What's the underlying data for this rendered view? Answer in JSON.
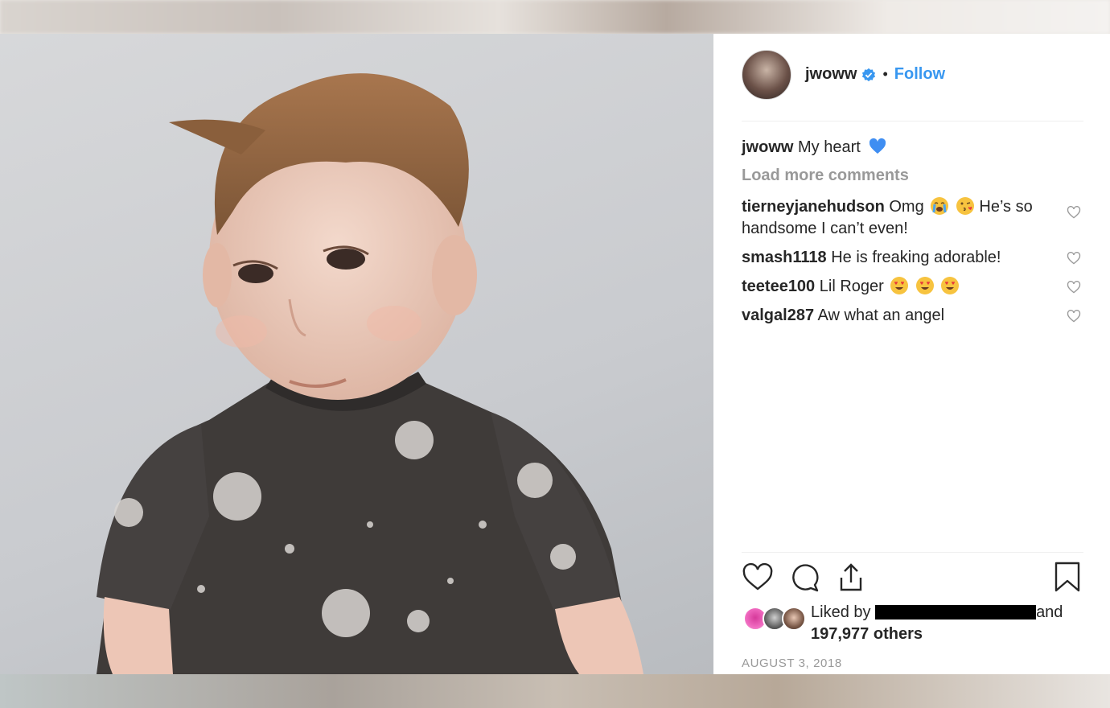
{
  "post": {
    "username": "jwoww",
    "separator": "•",
    "follow_label": "Follow",
    "caption_user": "jwoww",
    "caption_text": "My heart",
    "load_more": "Load more comments",
    "comments": [
      {
        "user": "tierneyjanehudson",
        "text_before": "Omg",
        "emojis": [
          "crying-face-icon",
          "kissing-heart-face-icon"
        ],
        "text_after": "He’s so handsome I can’t even!"
      },
      {
        "user": "smash1118",
        "text": "He is freaking adorable!"
      },
      {
        "user": "teetee100",
        "text": "Lil Roger",
        "emojis": [
          "heart-eyes-face-icon",
          "heart-eyes-face-icon",
          "heart-eyes-face-icon"
        ]
      },
      {
        "user": "valgal287",
        "text": "Aw what an angel"
      }
    ],
    "liked_by_prefix": "Liked by",
    "liked_by_suffix": "and",
    "liked_count": "197,977 others",
    "date": "AUGUST 3, 2018"
  },
  "colors": {
    "link_blue": "#3897f0",
    "muted_gray": "#999999",
    "text_dark": "#262626",
    "caption_heart": "#3f8ef2"
  },
  "icons": {
    "verified": "verified-badge-icon",
    "like": "heart-outline-icon",
    "comment": "comment-bubble-icon",
    "share": "share-upload-icon",
    "save": "bookmark-icon"
  }
}
